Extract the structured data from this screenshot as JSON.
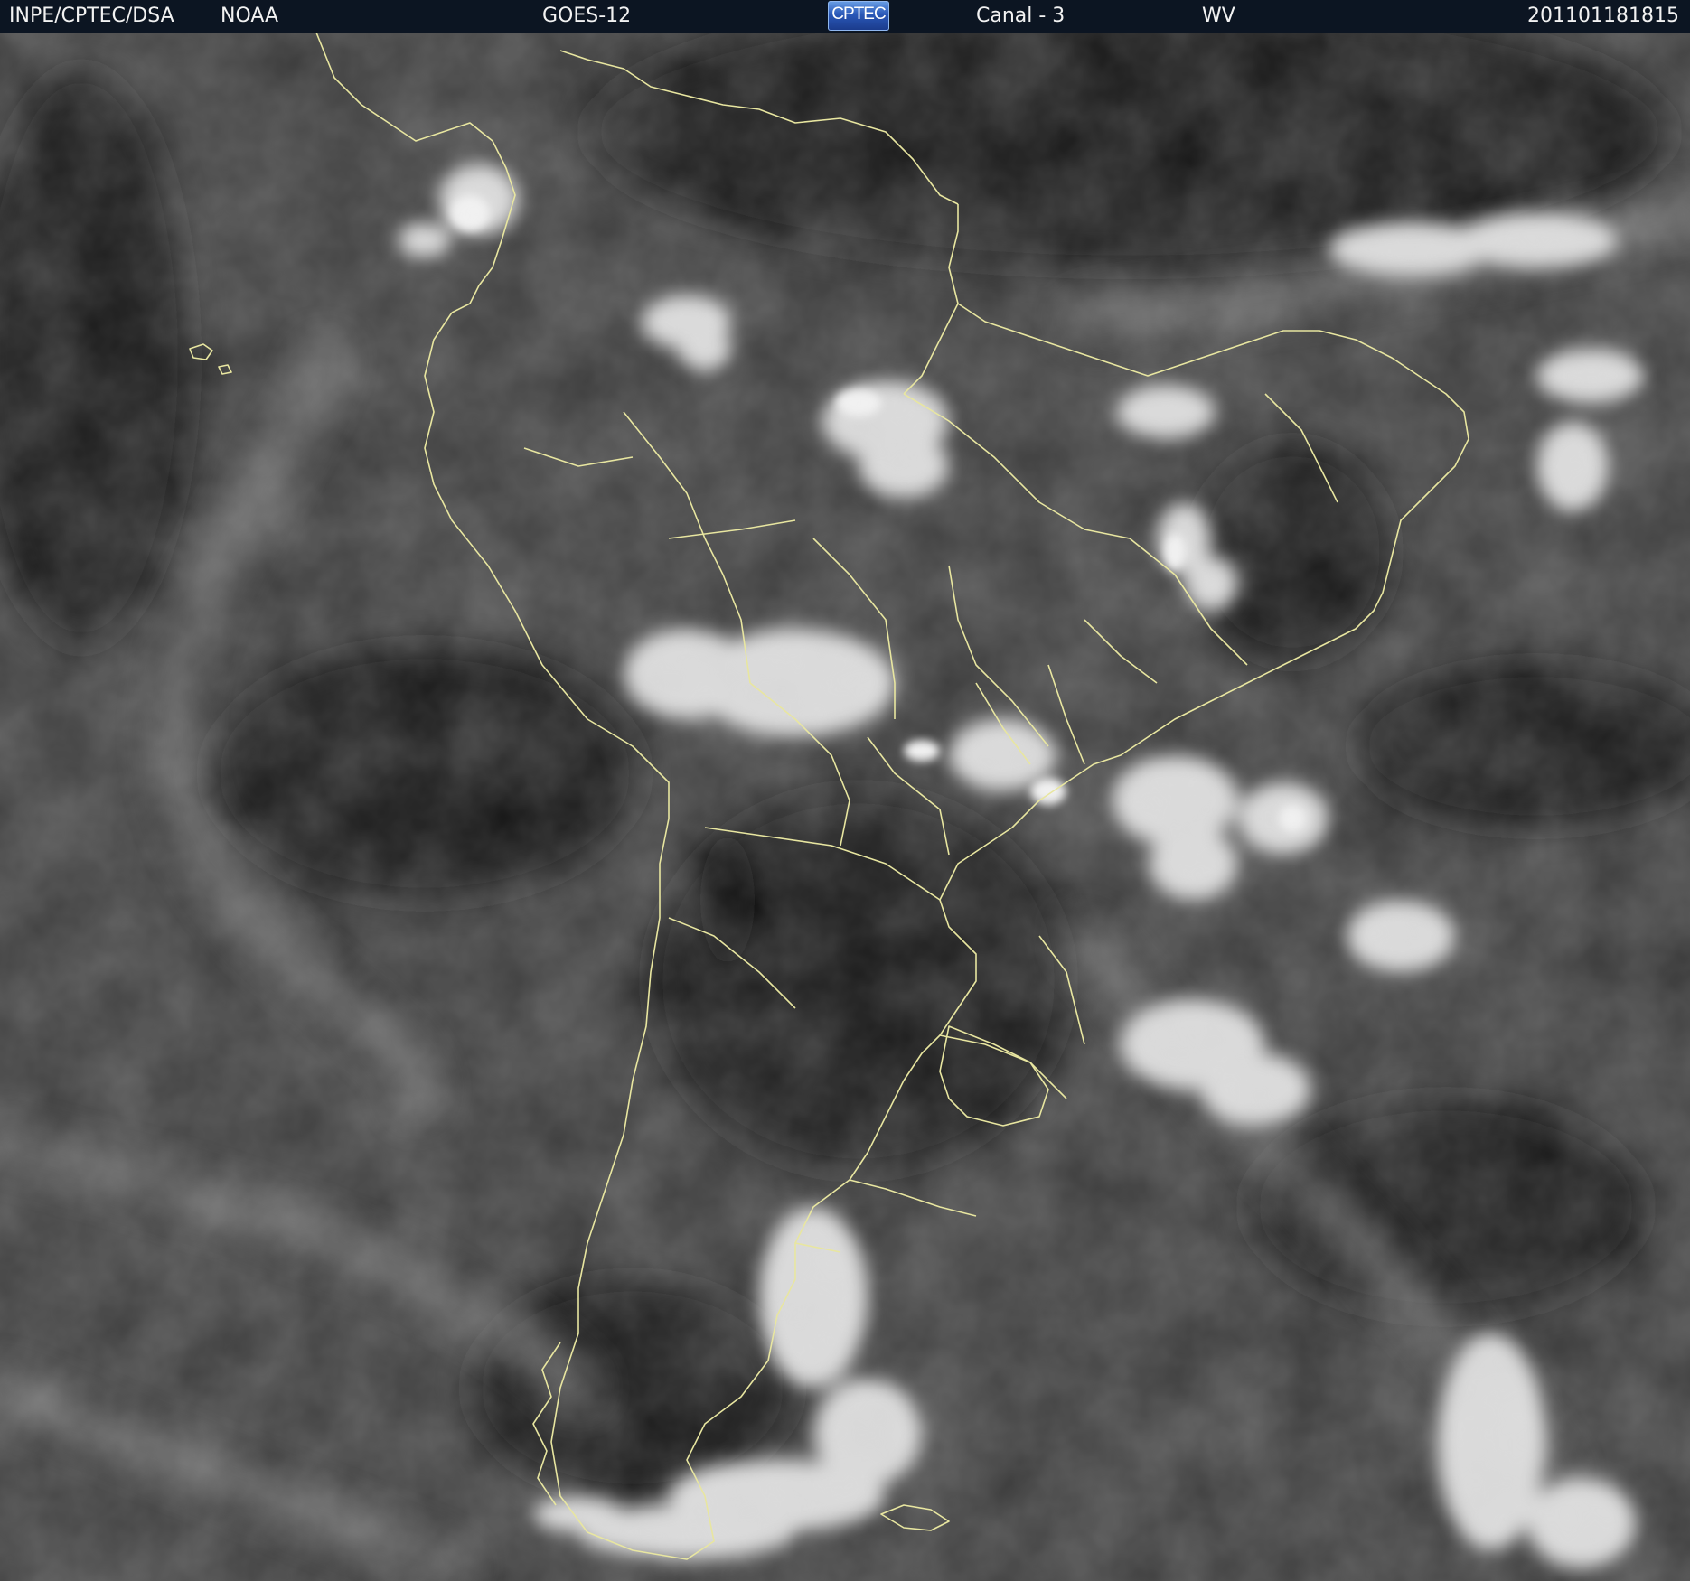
{
  "header": {
    "agency": "INPE/CPTEC/DSA",
    "provider": "NOAA",
    "satellite": "GOES-12",
    "logo_text": "CPTEC",
    "channel": "Canal - 3",
    "band": "WV",
    "timestamp": "201101181815"
  },
  "colors": {
    "header_background": "#0c1522",
    "header_text": "#f2f2f2",
    "coastline": "#e8e6a0",
    "logo_blue": "#2a58b8"
  },
  "imagery": {
    "type": "satellite water vapor image",
    "region": "South America",
    "rendering": "grayscale"
  }
}
